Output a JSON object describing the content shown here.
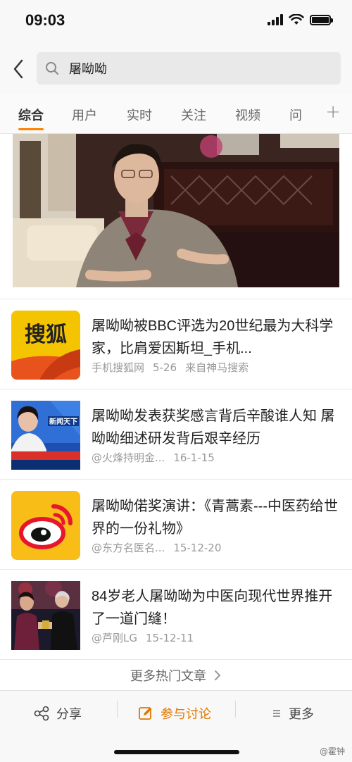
{
  "status_bar": {
    "time": "09:03"
  },
  "search": {
    "query": "屠呦呦"
  },
  "tabs": [
    {
      "label": "综合",
      "active": true
    },
    {
      "label": "用户"
    },
    {
      "label": "实时"
    },
    {
      "label": "关注"
    },
    {
      "label": "视频"
    },
    {
      "label": "问"
    }
  ],
  "tabs_plus": "+",
  "articles": [
    {
      "title": "屠呦呦被BBC评选为20世纪最为大科学家，比肩爱因斯坦_手机...",
      "source": "手机搜狐网",
      "date": "5-26",
      "via": "来自神马搜索",
      "thumb_icon": "sohu-logo-icon",
      "thumb_text": "搜狐"
    },
    {
      "title": "屠呦呦发表获奖感言背后辛酸谁人知 屠呦呦细述研发背后艰辛经历",
      "source": "@火烽持明金...",
      "date": "16-1-15",
      "thumb_icon": "news-anchor-thumbnail",
      "thumb_text": "新闻天下"
    },
    {
      "title": "屠呦呦偌奖演讲：《青蒿素---中医药给世界的一份礼物》",
      "source": "@东方名医名...",
      "date": "15-12-20",
      "thumb_icon": "weibo-logo-icon"
    },
    {
      "title": "84岁老人屠呦呦为中医向现代世界推开了一道门缝！",
      "source": "@芦刚LG",
      "date": "15-12-11",
      "thumb_icon": "award-ceremony-thumbnail"
    }
  ],
  "more_articles": "更多热门文章",
  "bottom_bar": {
    "share": "分享",
    "discuss": "参与讨论",
    "more": "更多"
  },
  "watermark": "@霍钟",
  "colors": {
    "accent": "#ff8200",
    "discuss": "#e07800"
  }
}
